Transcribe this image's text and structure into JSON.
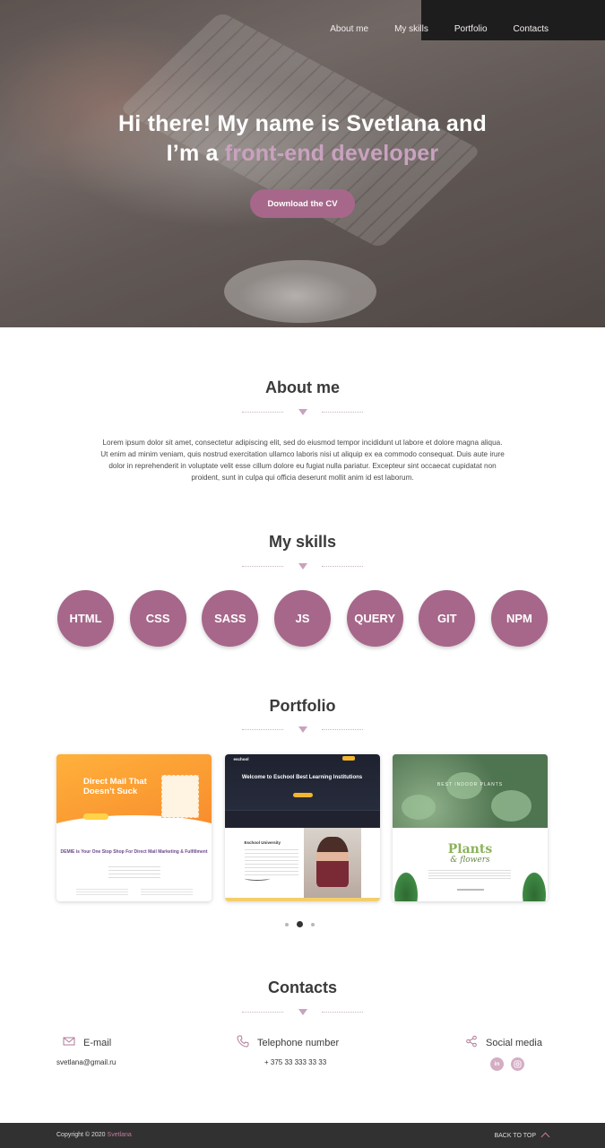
{
  "nav": {
    "about": "About me",
    "skills": "My skills",
    "portfolio": "Portfolio",
    "contacts": "Contacts"
  },
  "hero": {
    "line1": "Hi there! My name is Svetlana and",
    "line2_prefix": "I’m a ",
    "line2_accent": "front-end developer",
    "cv_button": "Download the CV"
  },
  "about": {
    "title": "About me",
    "text": "Lorem ipsum dolor sit amet, consectetur adipiscing elit, sed do eiusmod tempor incididunt ut labore et dolore magna aliqua. Ut enim ad minim veniam, quis nostrud exercitation ullamco laboris nisi ut aliquip ex ea commodo consequat. Duis aute irure dolor in reprehenderit in voluptate velit esse cillum dolore eu fugiat nulla pariatur. Excepteur sint occaecat cupidatat non proident, sunt in culpa qui officia deserunt mollit anim id est laborum."
  },
  "skills": {
    "title": "My skills",
    "items": [
      "HTML",
      "CSS",
      "SASS",
      "JS",
      "QUERY",
      "GIT",
      "NPM"
    ]
  },
  "portfolio": {
    "title": "Portfolio",
    "cards": [
      {
        "headline": "Direct Mail That Doesn’t Suck",
        "subtitle": "DEMIE is Your One Stop Shop For Direct Mail Marketing & Fulfillment"
      },
      {
        "logo": "eschool",
        "headline": "Welcome to Eschool Best Learning Institutions",
        "section": "Eschool University"
      },
      {
        "headline": "BEST INDOOR PLANTS",
        "title1": "Plants",
        "title2": "& flowers"
      }
    ],
    "slider": {
      "total": 3,
      "active": 2
    }
  },
  "contacts": {
    "title": "Contacts",
    "email_label": "E-mail",
    "email_value": "svetlana@gmail.ru",
    "phone_label": "Telephone number",
    "phone_value": "+ 375 33 333 33 33",
    "social_label": "Social media",
    "social_links": [
      "in",
      "ig"
    ]
  },
  "footer": {
    "copyright": "Copyright © 2020 ",
    "copyright_name": "Svetlana",
    "back_to_top": "BACK TO TOP"
  },
  "colors": {
    "accent": "#a6678a",
    "accent_light": "#c9a2bf",
    "footer_bg": "#313131"
  }
}
